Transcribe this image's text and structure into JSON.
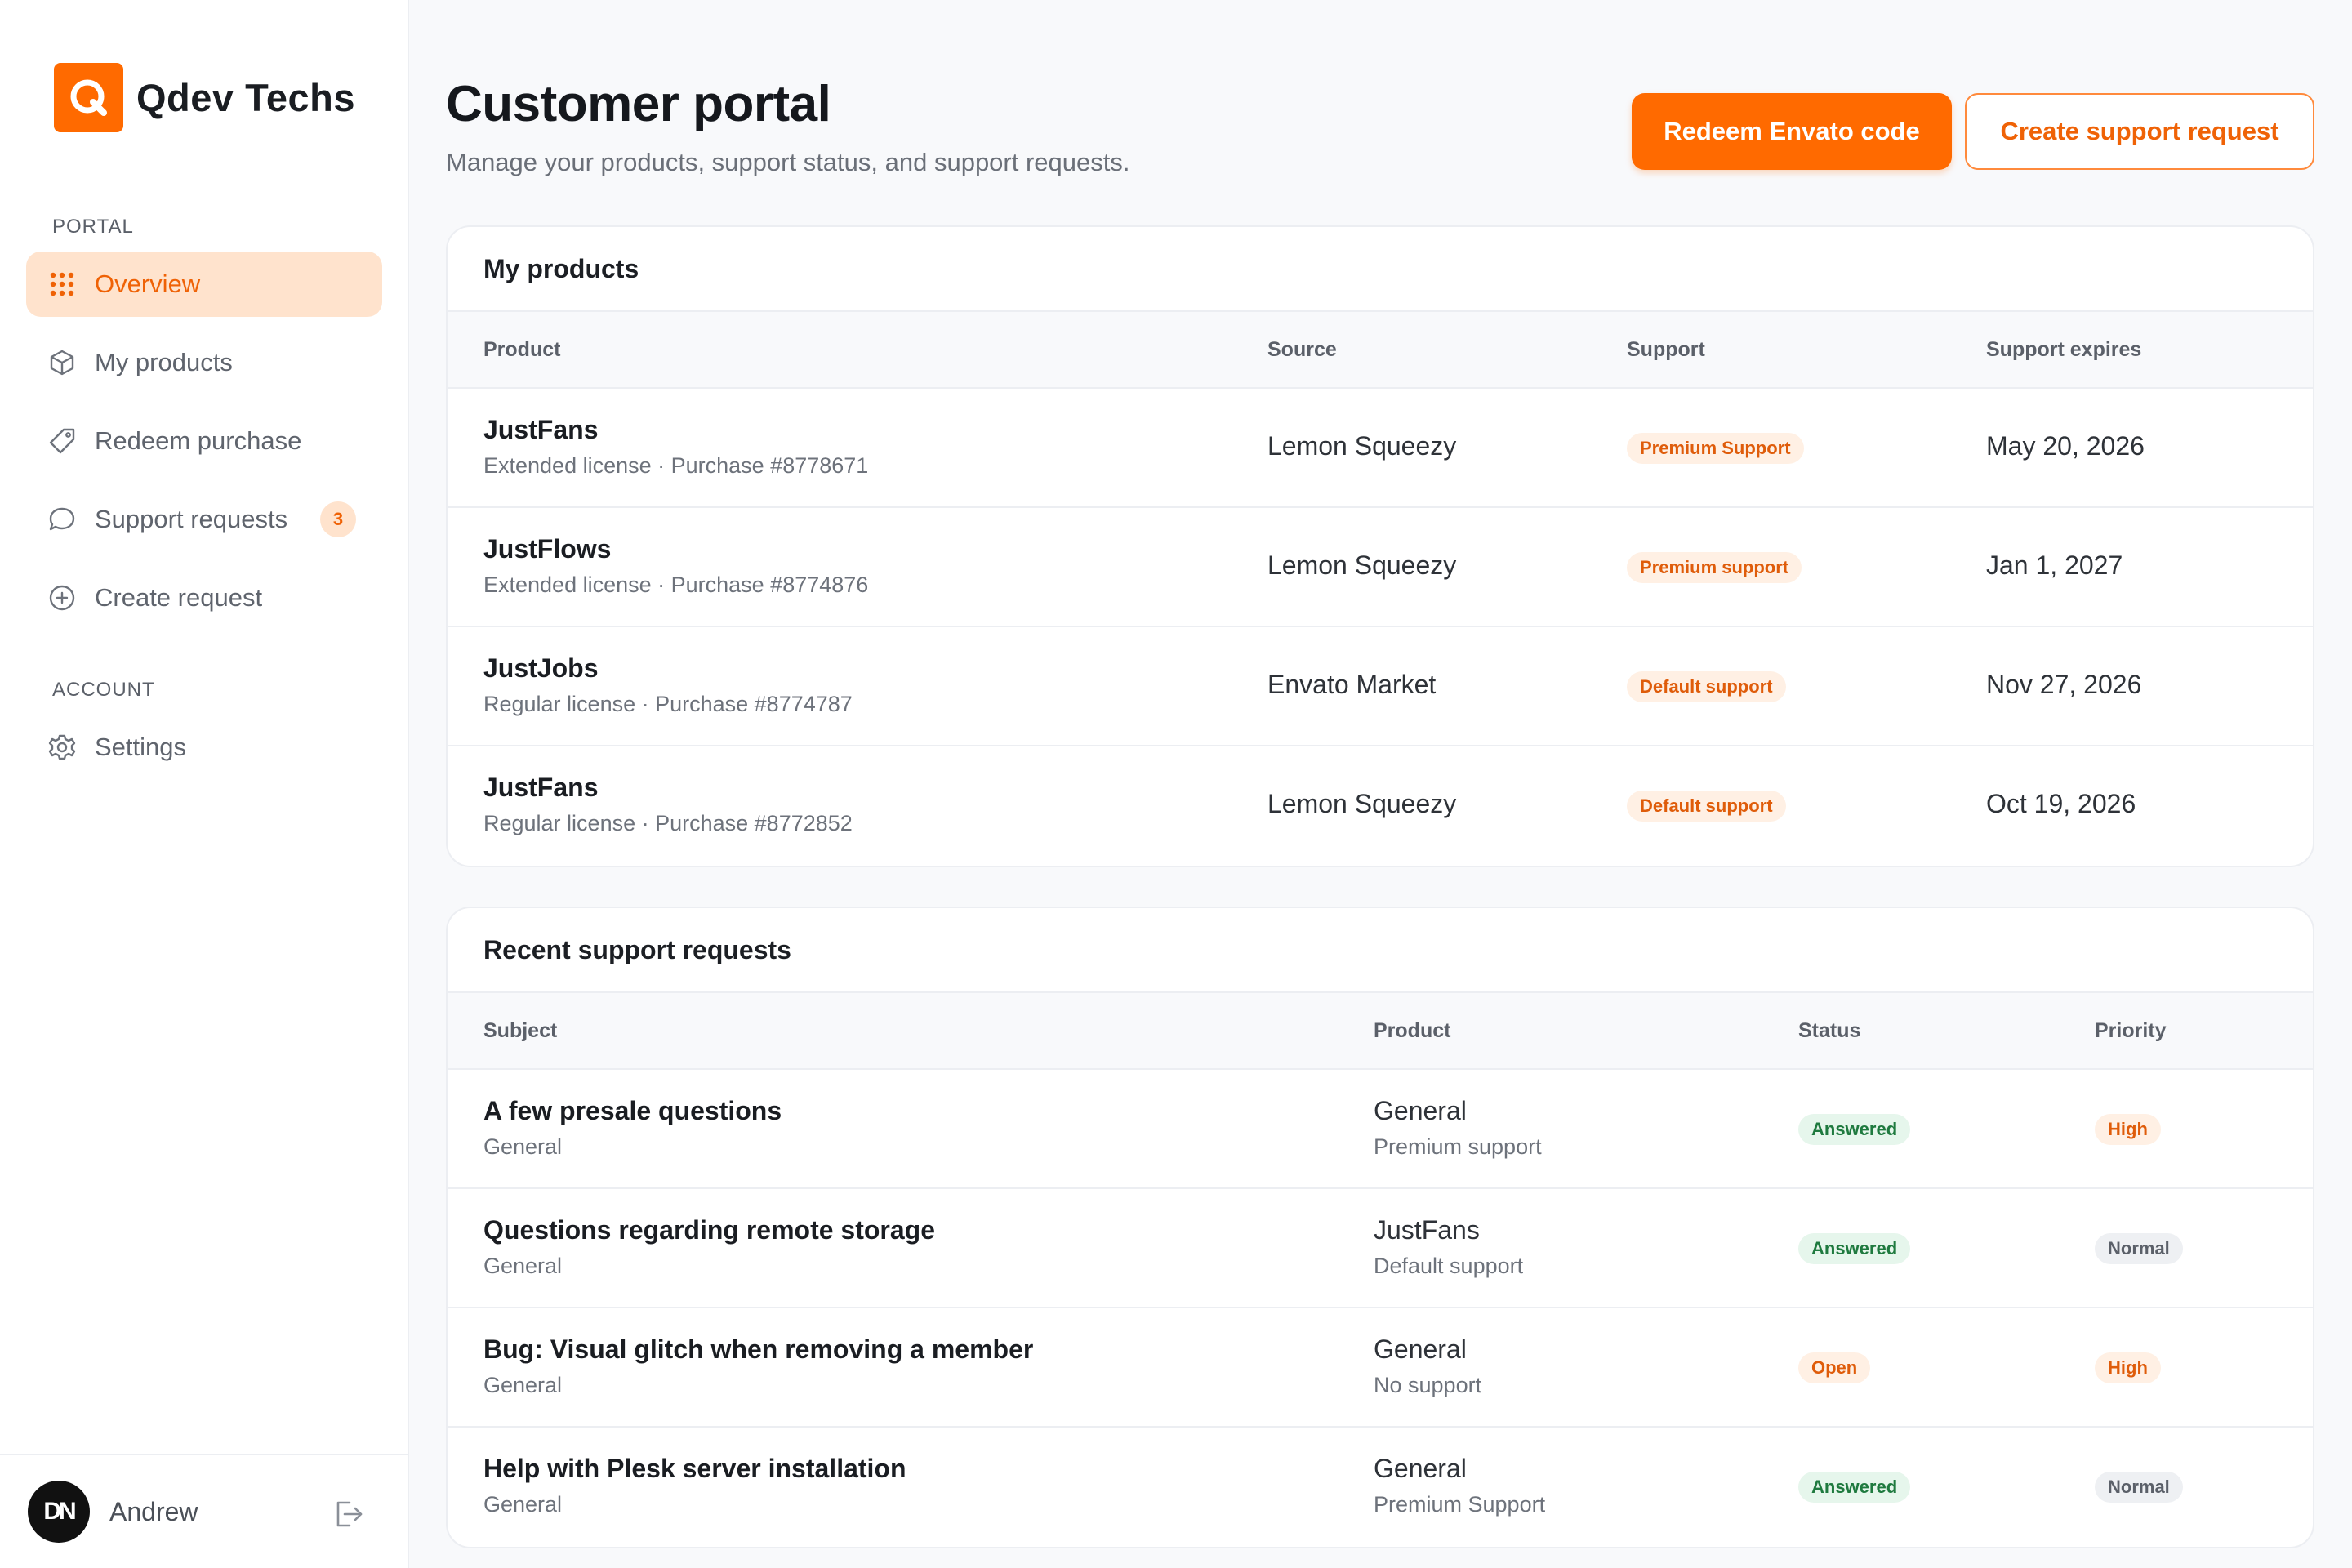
{
  "brand": {
    "name": "Qdev Techs"
  },
  "sidebar": {
    "portal_heading": "PORTAL",
    "account_heading": "ACCOUNT",
    "items": [
      {
        "label": "Overview",
        "icon": "grid-icon",
        "active": true
      },
      {
        "label": "My products",
        "icon": "box-icon"
      },
      {
        "label": "Redeem purchase",
        "icon": "tag-icon"
      },
      {
        "label": "Support requests",
        "icon": "chat-icon",
        "badge": "3"
      },
      {
        "label": "Create request",
        "icon": "plus-circle-icon"
      },
      {
        "label": "Settings",
        "icon": "gear-icon"
      }
    ],
    "user": {
      "name": "Andrew",
      "avatar_text": "DN"
    }
  },
  "header": {
    "title": "Customer portal",
    "subtitle": "Manage your products, support status, and support requests.",
    "redeem_label": "Redeem Envato code",
    "create_label": "Create support request"
  },
  "products": {
    "title": "My products",
    "columns": [
      "Product",
      "Source",
      "Support",
      "Support expires"
    ],
    "rows": [
      {
        "name": "JustFans",
        "meta": "Extended license · Purchase #8778671",
        "source": "Lemon Squeezy",
        "support": "Premium Support",
        "expires": "May 20, 2026"
      },
      {
        "name": "JustFlows",
        "meta": "Extended license · Purchase #8774876",
        "source": "Lemon Squeezy",
        "support": "Premium support",
        "expires": "Jan 1, 2027"
      },
      {
        "name": "JustJobs",
        "meta": "Regular license · Purchase #8774787",
        "source": "Envato Market",
        "support": "Default support",
        "expires": "Nov 27, 2026"
      },
      {
        "name": "JustFans",
        "meta": "Regular license · Purchase #8772852",
        "source": "Lemon Squeezy",
        "support": "Default support",
        "expires": "Oct 19, 2026"
      }
    ]
  },
  "requests": {
    "title": "Recent support requests",
    "columns": [
      "Subject",
      "Product",
      "Status",
      "Priority"
    ],
    "rows": [
      {
        "subject": "A few presale questions",
        "category": "General",
        "product": "General",
        "product_support": "Premium support",
        "status": "Answered",
        "priority": "High"
      },
      {
        "subject": "Questions regarding remote storage",
        "category": "General",
        "product": "JustFans",
        "product_support": "Default support",
        "status": "Answered",
        "priority": "Normal"
      },
      {
        "subject": "Bug: Visual glitch when removing a member",
        "category": "General",
        "product": "General",
        "product_support": "No support",
        "status": "Open",
        "priority": "High"
      },
      {
        "subject": "Help with Plesk server installation",
        "category": "General",
        "product": "General",
        "product_support": "Premium Support",
        "status": "Answered",
        "priority": "Normal"
      }
    ]
  },
  "colors": {
    "accent": "#ff6a00",
    "active_bg": "#ffe3cd",
    "answered": "#1f7a3f",
    "open": "#df5c0a"
  }
}
